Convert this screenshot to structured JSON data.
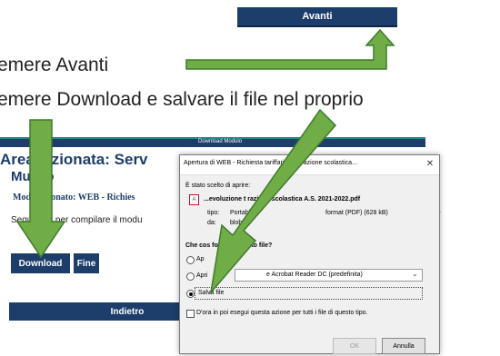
{
  "top": {
    "avanti_label": "Avanti"
  },
  "instructions": [
    "emere Avanti",
    "emere Download e salvare il file nel proprio"
  ],
  "page": {
    "bar_label": "Download Modulo",
    "title_line1": "Area s   zionata: Serv",
    "title_line2": "Museo",
    "module_selected": "Modulo s        onato: WEB - Richies",
    "hint": "Segui le is        per compilare il modu",
    "download_label": "Download",
    "fine_label": "Fine",
    "indietro_label": "Indietro",
    "more_dots": "..."
  },
  "dialog": {
    "title": "Apertura di WEB - Richiesta              tariffaria ristorazione scolastica...",
    "close_glyph": "✕",
    "chosen_label": "È stato scelto di aprire:",
    "pdf_icon_glyph": "A",
    "filename": "...evoluzione t            razione scolastica A.S. 2021-2022.pdf",
    "type_label": "tipo:",
    "type_value": "Portabl",
    "size_value": "format (PDF) (628 kB)",
    "from_label": "da:",
    "from_value": "blob:",
    "question": "Che cos             fox con questo file?",
    "option_open": "Ap",
    "option_open_with_label": "Apri",
    "option_open_with_value": "e Acrobat Reader DC (predefinita)",
    "option_save": "Salva file",
    "always_label": "D'ora in poi esegui questa azione per tutti i file di questo tipo.",
    "ok_label": "OK",
    "cancel_label": "Annulla",
    "selected_option": "Salva file"
  },
  "colors": {
    "navy": "#1d3d6b",
    "teal": "#1c8a7e",
    "arrow_green": "#70ad47"
  },
  "icons": [
    "close-icon",
    "pdf-icon",
    "chevron-down-icon",
    "arrow-icon"
  ]
}
